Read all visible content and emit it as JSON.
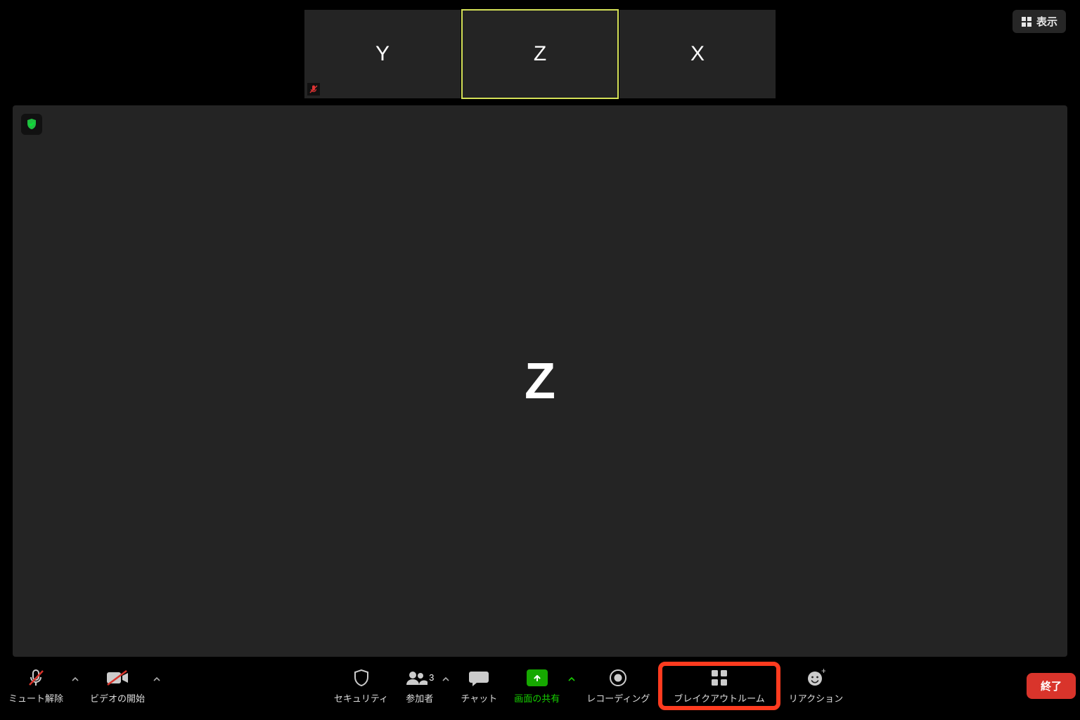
{
  "view_button": {
    "label": "表示"
  },
  "thumbnails": [
    {
      "letter": "Y",
      "active": false,
      "muted": true
    },
    {
      "letter": "Z",
      "active": true,
      "muted": false
    },
    {
      "letter": "X",
      "active": false,
      "muted": false
    }
  ],
  "main_speaker": {
    "letter": "Z"
  },
  "toolbar": {
    "mute": {
      "label": "ミュート解除"
    },
    "video": {
      "label": "ビデオの開始"
    },
    "security": {
      "label": "セキュリティ"
    },
    "participants": {
      "label": "参加者",
      "count": "3"
    },
    "chat": {
      "label": "チャット"
    },
    "share": {
      "label": "画面の共有"
    },
    "record": {
      "label": "レコーディング"
    },
    "breakout": {
      "label": "ブレイクアウトルーム"
    },
    "reactions": {
      "label": "リアクション"
    },
    "end": {
      "label": "終了"
    }
  }
}
